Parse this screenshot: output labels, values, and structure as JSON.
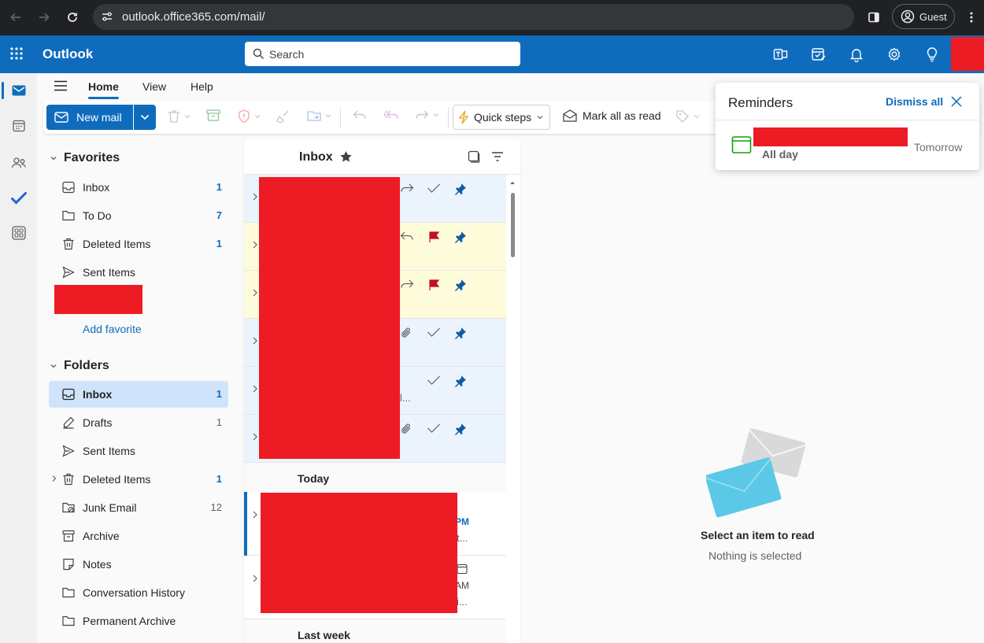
{
  "browser": {
    "url": "outlook.office365.com/mail/",
    "profile_label": "Guest"
  },
  "app": {
    "name": "Outlook",
    "brand_color": "#0f6cbd",
    "search_placeholder": "Search"
  },
  "ribbon": {
    "tabs": [
      "Home",
      "View",
      "Help"
    ],
    "active_tab": "Home",
    "new_mail_label": "New mail",
    "quick_steps_label": "Quick steps",
    "mark_all_read_label": "Mark all as read"
  },
  "favorites": {
    "header": "Favorites",
    "items": [
      {
        "label": "Inbox",
        "count": "1",
        "icon": "inbox-icon"
      },
      {
        "label": "To Do",
        "count": "7",
        "icon": "folder-icon"
      },
      {
        "label": "Deleted Items",
        "count": "1",
        "icon": "trash-icon"
      },
      {
        "label": "Sent Items",
        "count": "",
        "icon": "send-icon"
      }
    ],
    "add_favorite_label": "Add favorite"
  },
  "folders": {
    "header": "Folders",
    "items": [
      {
        "label": "Inbox",
        "count": "1",
        "icon": "inbox-icon",
        "active": true
      },
      {
        "label": "Drafts",
        "count": "1",
        "icon": "drafts-icon"
      },
      {
        "label": "Sent Items",
        "count": "",
        "icon": "send-icon"
      },
      {
        "label": "Deleted Items",
        "count": "1",
        "icon": "trash-icon"
      },
      {
        "label": "Junk Email",
        "count": "12",
        "icon": "junk-icon"
      },
      {
        "label": "Archive",
        "count": "",
        "icon": "archive-icon"
      },
      {
        "label": "Notes",
        "count": "",
        "icon": "notes-icon"
      },
      {
        "label": "Conversation History",
        "count": "",
        "icon": "folder-icon"
      },
      {
        "label": "Permanent Archive",
        "count": "",
        "icon": "folder-icon"
      }
    ]
  },
  "message_list": {
    "title": "Inbox",
    "group_today": "Today",
    "group_last_week": "Last week",
    "pinned_rows": [
      {
        "snippet": "",
        "action_icon": "forward-icon",
        "state_icon": "check-icon",
        "flagged": false
      },
      {
        "snippet": "",
        "action_icon": "reply-icon",
        "state_icon": "flag-icon",
        "flagged": true
      },
      {
        "snippet": "",
        "action_icon": "forward-icon",
        "state_icon": "flag-icon",
        "flagged": true
      },
      {
        "snippet": "",
        "action_icon": "paperclip-icon",
        "state_icon": "check-icon",
        "flagged": false
      },
      {
        "snippet": "l...",
        "action_icon": "",
        "state_icon": "check-icon",
        "flagged": false
      },
      {
        "snippet": "",
        "action_icon": "paperclip-icon",
        "state_icon": "check-icon",
        "flagged": false
      }
    ],
    "today_rows": [
      {
        "time": "PM",
        "snippet": "t..."
      },
      {
        "time": "AM",
        "snippet": "i..."
      }
    ]
  },
  "reading_pane": {
    "empty_title": "Select an item to read",
    "empty_subtitle": "Nothing is selected"
  },
  "reminders": {
    "title": "Reminders",
    "dismiss_all_label": "Dismiss all",
    "item": {
      "time_label": "All day",
      "when": "Tomorrow"
    }
  }
}
